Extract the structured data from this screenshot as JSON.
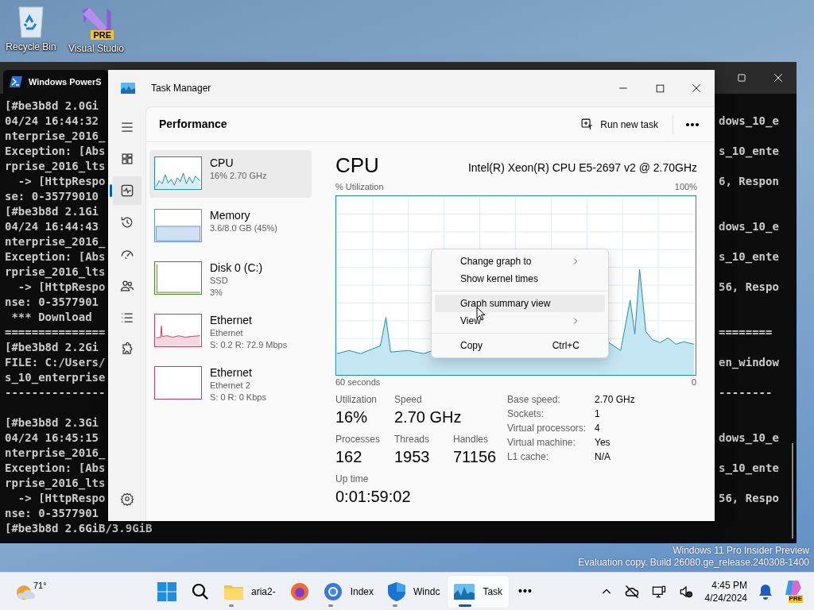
{
  "desktop_icons": [
    {
      "kind": "recycle",
      "label": "Recycle Bin"
    },
    {
      "kind": "vs",
      "label": "Visual Studio",
      "badge": "PRE"
    }
  ],
  "terminal": {
    "title": "Windows PowerS",
    "left_lines": [
      {
        "kind": "text",
        "text": "[#be3b8d 2.0Gi"
      },
      {
        "kind": "text",
        "text": "04/24 16:44:32"
      },
      {
        "kind": "text",
        "text": "nterprise_2016_"
      },
      {
        "kind": "text",
        "text": "Exception: [Abs"
      },
      {
        "kind": "text",
        "text": "rprise_2016_lts"
      },
      {
        "kind": "text",
        "text": "  -> [HttpRespo"
      },
      {
        "kind": "text",
        "text": "se: 0-35779010"
      },
      {
        "kind": "text",
        "text": "[#be3b8d 2.1Gi"
      },
      {
        "kind": "text",
        "text": "04/24 16:44:43"
      },
      {
        "kind": "text",
        "text": "nterprise_2016_"
      },
      {
        "kind": "text",
        "text": "Exception: [Abs"
      },
      {
        "kind": "text",
        "text": "rprise_2016_lts"
      },
      {
        "kind": "text",
        "text": "  -> [HttpRespo"
      },
      {
        "kind": "text",
        "text": "nse: 0-3577901"
      },
      {
        "kind": "text",
        "text": " *** Download"
      },
      {
        "kind": "text",
        "text": "==============="
      },
      {
        "kind": "text",
        "text": "[#be3b8d 2.2Gi"
      },
      {
        "kind": "text",
        "text": "FILE: C:/Users/"
      },
      {
        "kind": "text",
        "text": "s_10_enterprise"
      },
      {
        "kind": "text",
        "text": "---------------"
      },
      {
        "kind": "blank"
      },
      {
        "kind": "text",
        "text": "[#be3b8d 2.3Gi"
      },
      {
        "kind": "text",
        "text": "04/24 16:45:15"
      },
      {
        "kind": "text",
        "text": "nterprise_2016_"
      },
      {
        "kind": "text",
        "text": "Exception: [Abs"
      },
      {
        "kind": "text",
        "text": "rprise_2016_lts"
      },
      {
        "kind": "text",
        "text": "  -> [HttpRespo"
      },
      {
        "kind": "text",
        "text": "nse: 0-3577901"
      },
      {
        "kind": "text",
        "text": "[#be3b8d 2.6GiB/3.9GiB"
      }
    ],
    "right_lines": [
      {
        "kind": "blank"
      },
      {
        "kind": "text",
        "text": "dows_10_e"
      },
      {
        "kind": "blank"
      },
      {
        "kind": "text",
        "text": "s_10_ente"
      },
      {
        "kind": "blank"
      },
      {
        "kind": "text",
        "text": "6, Respon"
      },
      {
        "kind": "blank"
      },
      {
        "kind": "blank"
      },
      {
        "kind": "text",
        "text": "dows_10_e"
      },
      {
        "kind": "blank"
      },
      {
        "kind": "text",
        "text": "s_10_ente"
      },
      {
        "kind": "blank"
      },
      {
        "kind": "text",
        "text": "56, Respo"
      },
      {
        "kind": "blank"
      },
      {
        "kind": "blank"
      },
      {
        "kind": "text",
        "text": "========"
      },
      {
        "kind": "blank"
      },
      {
        "kind": "text",
        "text": "en_window"
      },
      {
        "kind": "blank"
      },
      {
        "kind": "text",
        "text": "--------"
      },
      {
        "kind": "blank"
      },
      {
        "kind": "blank"
      },
      {
        "kind": "text",
        "text": "dows_10_e"
      },
      {
        "kind": "blank"
      },
      {
        "kind": "text",
        "text": "s_10_ente"
      },
      {
        "kind": "blank"
      },
      {
        "kind": "text",
        "text": "56, Respo"
      }
    ]
  },
  "task_manager": {
    "title": "Task Manager",
    "header": "Performance",
    "run_new_task": "Run new task",
    "nav": [
      {
        "kind": "menu",
        "selected": false
      },
      {
        "kind": "processes",
        "selected": false
      },
      {
        "kind": "performance",
        "selected": true
      },
      {
        "kind": "history",
        "selected": false
      },
      {
        "kind": "startup",
        "selected": false
      },
      {
        "kind": "users",
        "selected": false
      },
      {
        "kind": "details",
        "selected": false
      },
      {
        "kind": "services",
        "selected": false
      }
    ],
    "devices": [
      {
        "kind": "cpu",
        "name": "CPU",
        "lines": [
          "16% 2.70 GHz"
        ],
        "color": "#1b8cb1",
        "selected": true
      },
      {
        "kind": "memory",
        "name": "Memory",
        "lines": [
          "3.6/8.0 GB (45%)"
        ],
        "color": "#6a92c9",
        "selected": false
      },
      {
        "kind": "disk",
        "name": "Disk 0 (C:)",
        "lines": [
          "SSD",
          "3%"
        ],
        "color": "#4d8a1f",
        "selected": false
      },
      {
        "kind": "ethernet",
        "name": "Ethernet",
        "lines": [
          "Ethernet",
          "S: 0.2 R: 72.9 Mbps"
        ],
        "color": "#c43c64",
        "selected": false
      },
      {
        "kind": "idle",
        "name": "Ethernet",
        "lines": [
          "Ethernet 2",
          "S: 0 R: 0 Kbps"
        ],
        "color": "#c43c64",
        "selected": false
      }
    ],
    "detail": {
      "title": "CPU",
      "model": "Intel(R) Xeon(R) CPU E5-2697 v2 @ 2.70GHz",
      "graph_label": "% Utilization",
      "graph_max": "100%",
      "graph_time": "60 seconds",
      "graph_min": "0",
      "stats": [
        [
          {
            "label": "Utilization",
            "value": "16%"
          },
          {
            "label": "Speed",
            "value": "2.70 GHz"
          }
        ],
        [
          {
            "label": "Processes",
            "value": "162"
          },
          {
            "label": "Threads",
            "value": "1953"
          },
          {
            "label": "Handles",
            "value": "71156"
          }
        ],
        [
          {
            "label": "Up time",
            "value": "0:01:59:02"
          }
        ]
      ],
      "specs": [
        {
          "label": "Base speed:",
          "value": "2.70 GHz"
        },
        {
          "label": "Sockets:",
          "value": "1"
        },
        {
          "label": "Virtual processors:",
          "value": "4"
        },
        {
          "label": "Virtual machine:",
          "value": "Yes"
        },
        {
          "label": "L1 cache:",
          "value": "N/A"
        }
      ]
    },
    "context_menu": [
      {
        "kind": "item",
        "label": "Change graph to",
        "submenu": true,
        "selected": false
      },
      {
        "kind": "item",
        "label": "Show kernel times",
        "submenu": false,
        "selected": false
      },
      {
        "kind": "separator"
      },
      {
        "kind": "item",
        "label": "Graph summary view",
        "submenu": false,
        "selected": true
      },
      {
        "kind": "item",
        "label": "View",
        "submenu": true,
        "selected": false
      },
      {
        "kind": "separator"
      },
      {
        "kind": "item",
        "label": "Copy",
        "shortcut": "Ctrl+C",
        "submenu": false,
        "selected": false
      }
    ]
  },
  "watermark": [
    "Windows 11 Pro Insider Preview",
    "Evaluation copy. Build 26080.ge_release.240308-1400"
  ],
  "taskbar": {
    "weather": "71°",
    "apps": [
      {
        "kind": "start",
        "running": false,
        "selected": false
      },
      {
        "kind": "search",
        "running": false,
        "selected": false
      },
      {
        "kind": "folder",
        "label": "aria2-",
        "running": true,
        "selected": false
      },
      {
        "kind": "firefox",
        "running": false,
        "selected": false
      },
      {
        "kind": "chrome",
        "label": "Index",
        "running": true,
        "selected": false
      },
      {
        "kind": "shield",
        "label": "Windc",
        "running": true,
        "selected": false
      },
      {
        "kind": "taskmgr",
        "label": "Task",
        "running": true,
        "selected": true
      }
    ],
    "more": "•••",
    "time": "4:45 PM",
    "date": "4/24/2024",
    "copilot_badge": "PRE"
  }
}
